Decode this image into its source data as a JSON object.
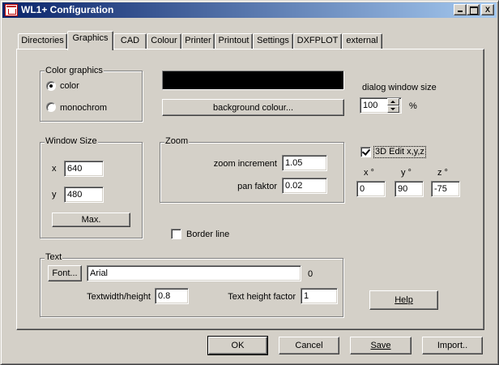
{
  "window": {
    "title": "WL1+ Configuration",
    "minimize_label": "",
    "maximize_label": "",
    "close_label": "X"
  },
  "tabs": [
    {
      "label": "Directories"
    },
    {
      "label": "Graphics",
      "active": true
    },
    {
      "label": "CAD"
    },
    {
      "label": "Colour"
    },
    {
      "label": "Printer"
    },
    {
      "label": "Printout"
    },
    {
      "label": "Settings"
    },
    {
      "label": "DXFPLOT"
    },
    {
      "label": "external"
    }
  ],
  "color_graphics": {
    "title": "Color graphics",
    "options": [
      {
        "label": "color",
        "selected": true
      },
      {
        "label": "monochrom",
        "selected": false
      }
    ]
  },
  "background": {
    "swatch_color": "#000000",
    "button_label": "background colour..."
  },
  "dialog_window_size": {
    "label": "dialog window size",
    "value": "100",
    "unit": "%"
  },
  "window_size": {
    "title": "Window Size",
    "x_label": "x",
    "x_value": "640",
    "y_label": "y",
    "y_value": "480",
    "max_label": "Max."
  },
  "zoom": {
    "title": "Zoom",
    "increment_label": "zoom increment",
    "increment_value": "1.05",
    "pan_label": "pan faktor",
    "pan_value": "0.02"
  },
  "edit3d": {
    "label": "3D Edit x,y,z",
    "checked": true,
    "x_label": "x °",
    "x_value": "0",
    "y_label": "y °",
    "y_value": "90",
    "z_label": "z °",
    "z_value": "-75"
  },
  "border_line": {
    "label": "Border line",
    "checked": false
  },
  "text": {
    "title": "Text",
    "font_button": "Font...",
    "font_value": "Arial",
    "font_index": "0",
    "width_height_label": "Textwidth/height",
    "width_height_value": "0.8",
    "height_factor_label": "Text height factor",
    "height_factor_value": "1"
  },
  "help_label": "Help",
  "footer": {
    "ok": "OK",
    "cancel": "Cancel",
    "save": "Save",
    "import": "Import.."
  }
}
